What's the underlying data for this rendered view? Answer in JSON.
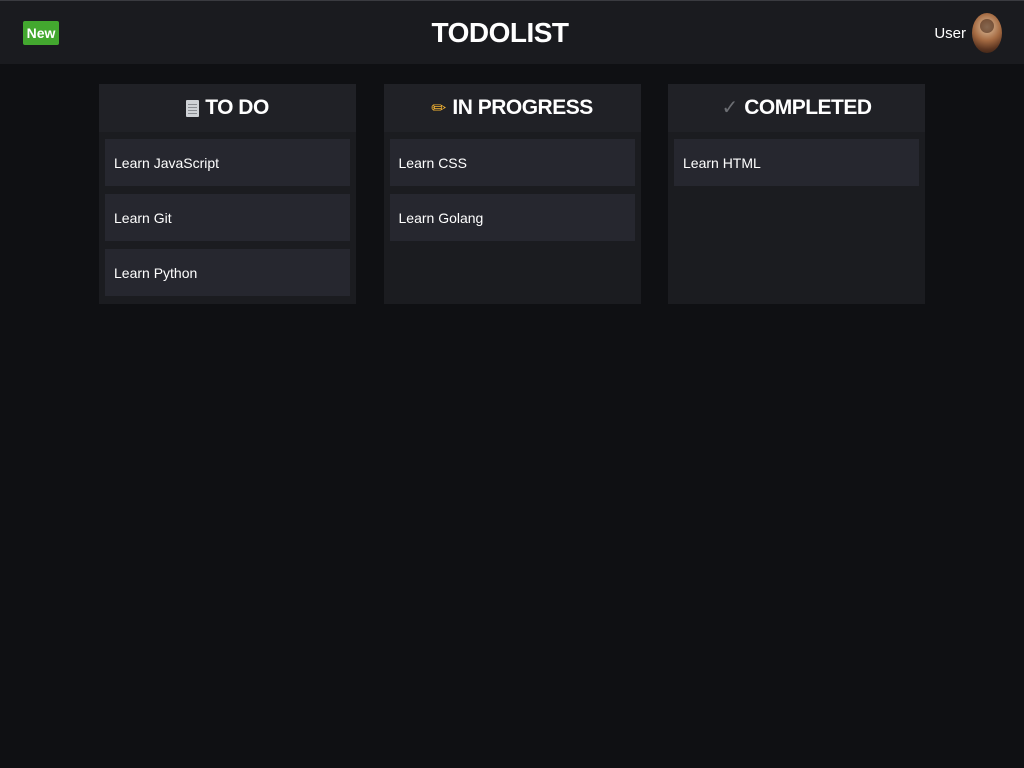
{
  "header": {
    "new_label": "New",
    "title": "TODOLIST",
    "user_label": "User"
  },
  "columns": [
    {
      "icon": "document-icon",
      "title": "TO DO",
      "cards": [
        "Learn JavaScript",
        "Learn Git",
        "Learn Python"
      ]
    },
    {
      "icon": "pencil-icon",
      "title": "IN PROGRESS",
      "cards": [
        "Learn CSS",
        "Learn Golang"
      ]
    },
    {
      "icon": "check-icon",
      "title": "COMPLETED",
      "cards": [
        "Learn HTML"
      ]
    }
  ],
  "colors": {
    "background": "#0f1013",
    "topbar": "#1a1b1f",
    "column": "#1b1c20",
    "card": "#26272f",
    "new_button": "#43a82f"
  }
}
